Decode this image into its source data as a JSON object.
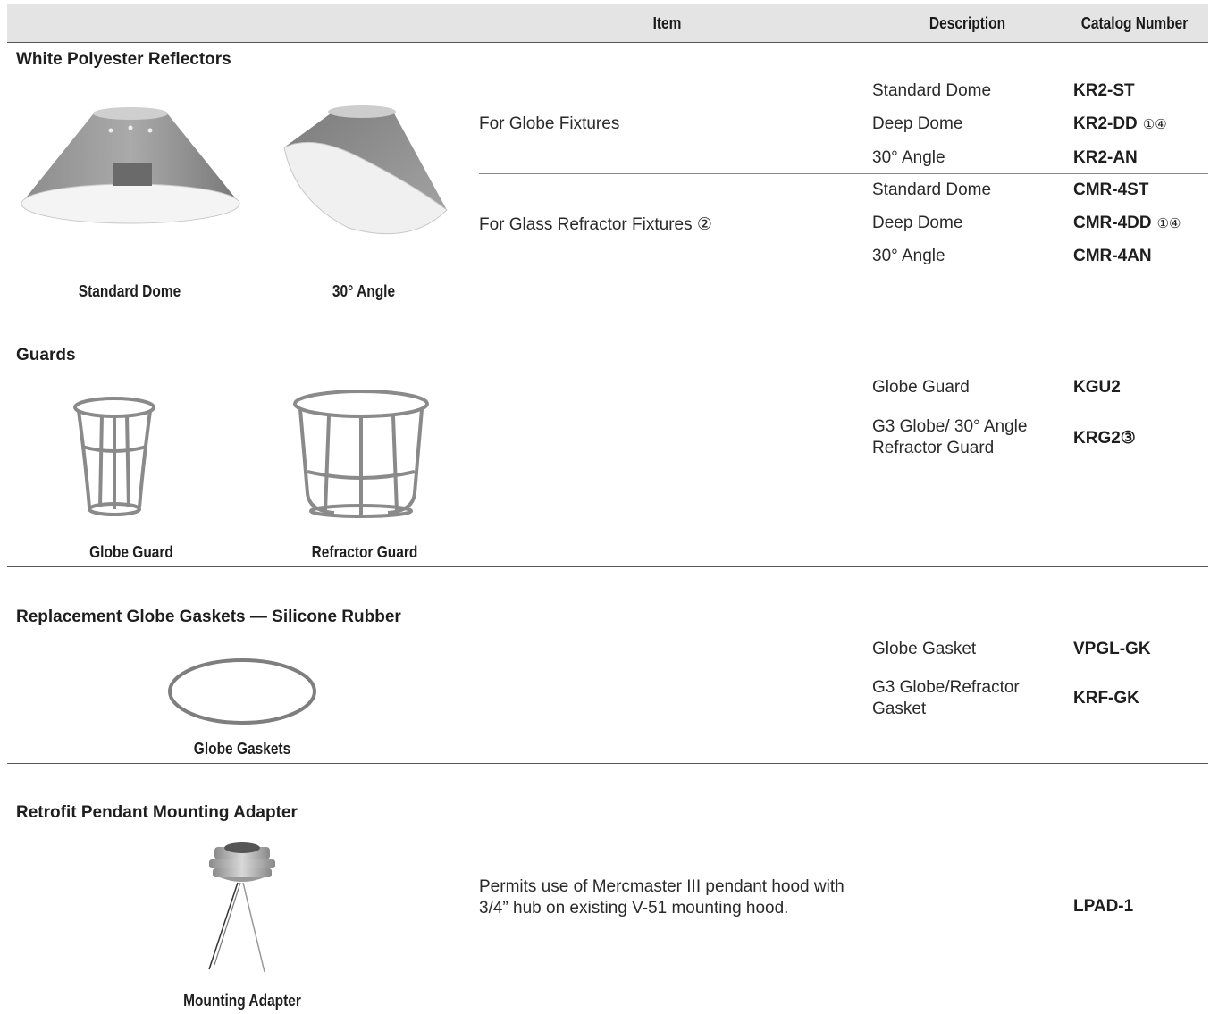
{
  "header": {
    "item": "Item",
    "description": "Description",
    "catalog": "Catalog Number"
  },
  "sections": {
    "reflectors": {
      "title": "White Polyester Reflectors",
      "captions": [
        "Standard Dome",
        "30° Angle"
      ],
      "groups": [
        {
          "item": "For Globe Fixtures",
          "rows": [
            {
              "desc": "Standard Dome",
              "cat": "KR2-ST",
              "note": ""
            },
            {
              "desc": "Deep Dome",
              "cat": "KR2-DD",
              "note": "①④"
            },
            {
              "desc": "30° Angle",
              "cat": "KR2-AN",
              "note": ""
            }
          ]
        },
        {
          "item": "For Glass Refractor Fixtures ②",
          "rows": [
            {
              "desc": "Standard Dome",
              "cat": "CMR-4ST",
              "note": ""
            },
            {
              "desc": "Deep Dome",
              "cat": "CMR-4DD",
              "note": "①④"
            },
            {
              "desc": "30° Angle",
              "cat": "CMR-4AN",
              "note": ""
            }
          ]
        }
      ]
    },
    "guards": {
      "title": "Guards",
      "captions": [
        "Globe Guard",
        "Refractor Guard"
      ],
      "rows": [
        {
          "desc": "Globe Guard",
          "cat": "KGU2"
        },
        {
          "desc": "G3 Globe/ 30° Angle Refractor Guard",
          "cat": "KRG2③"
        }
      ]
    },
    "gaskets": {
      "title": "Replacement Globe Gaskets — Silicone Rubber",
      "captions": [
        "Globe Gaskets"
      ],
      "rows": [
        {
          "desc": "Globe Gasket",
          "cat": "VPGL-GK"
        },
        {
          "desc": "G3 Globe/Refractor Gasket",
          "cat": "KRF-GK"
        }
      ]
    },
    "adapter": {
      "title": "Retrofit Pendant Mounting Adapter",
      "captions": [
        "Mounting Adapter"
      ],
      "item": "Permits use of Mercmaster III pendant hood with 3/4” hub on existing V-51 mounting hood.",
      "cat": "LPAD-1"
    }
  }
}
